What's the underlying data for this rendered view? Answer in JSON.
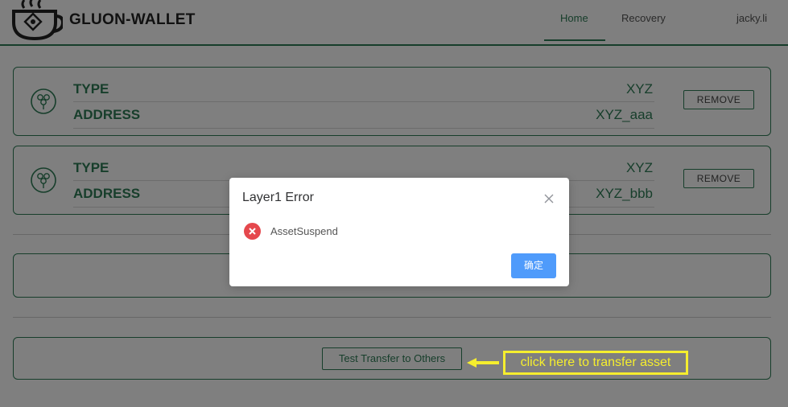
{
  "header": {
    "app_name": "GLUON-WALLET",
    "nav": {
      "home": "Home",
      "recovery": "Recovery",
      "user": "jacky.li"
    }
  },
  "assets": [
    {
      "type_label": "TYPE",
      "type_value": "XYZ",
      "address_label": "ADDRESS",
      "address_value": "XYZ_aaa",
      "remove_label": "REMOVE"
    },
    {
      "type_label": "TYPE",
      "type_value": "XYZ",
      "address_label": "ADDRESS",
      "address_value": "XYZ_bbb",
      "remove_label": "REMOVE"
    }
  ],
  "transfer": {
    "button_label": "Test Transfer to Others"
  },
  "annotation": {
    "text": "click here to transfer asset",
    "color": "#f5ee2e"
  },
  "dialog": {
    "title": "Layer1 Error",
    "message": "AssetSuspend",
    "confirm_label": "确定",
    "icon": "error-icon",
    "close_icon": "close-icon"
  },
  "colors": {
    "accent": "#2e7d57",
    "primary_button": "#4f9bfb",
    "error": "#e5484d"
  }
}
